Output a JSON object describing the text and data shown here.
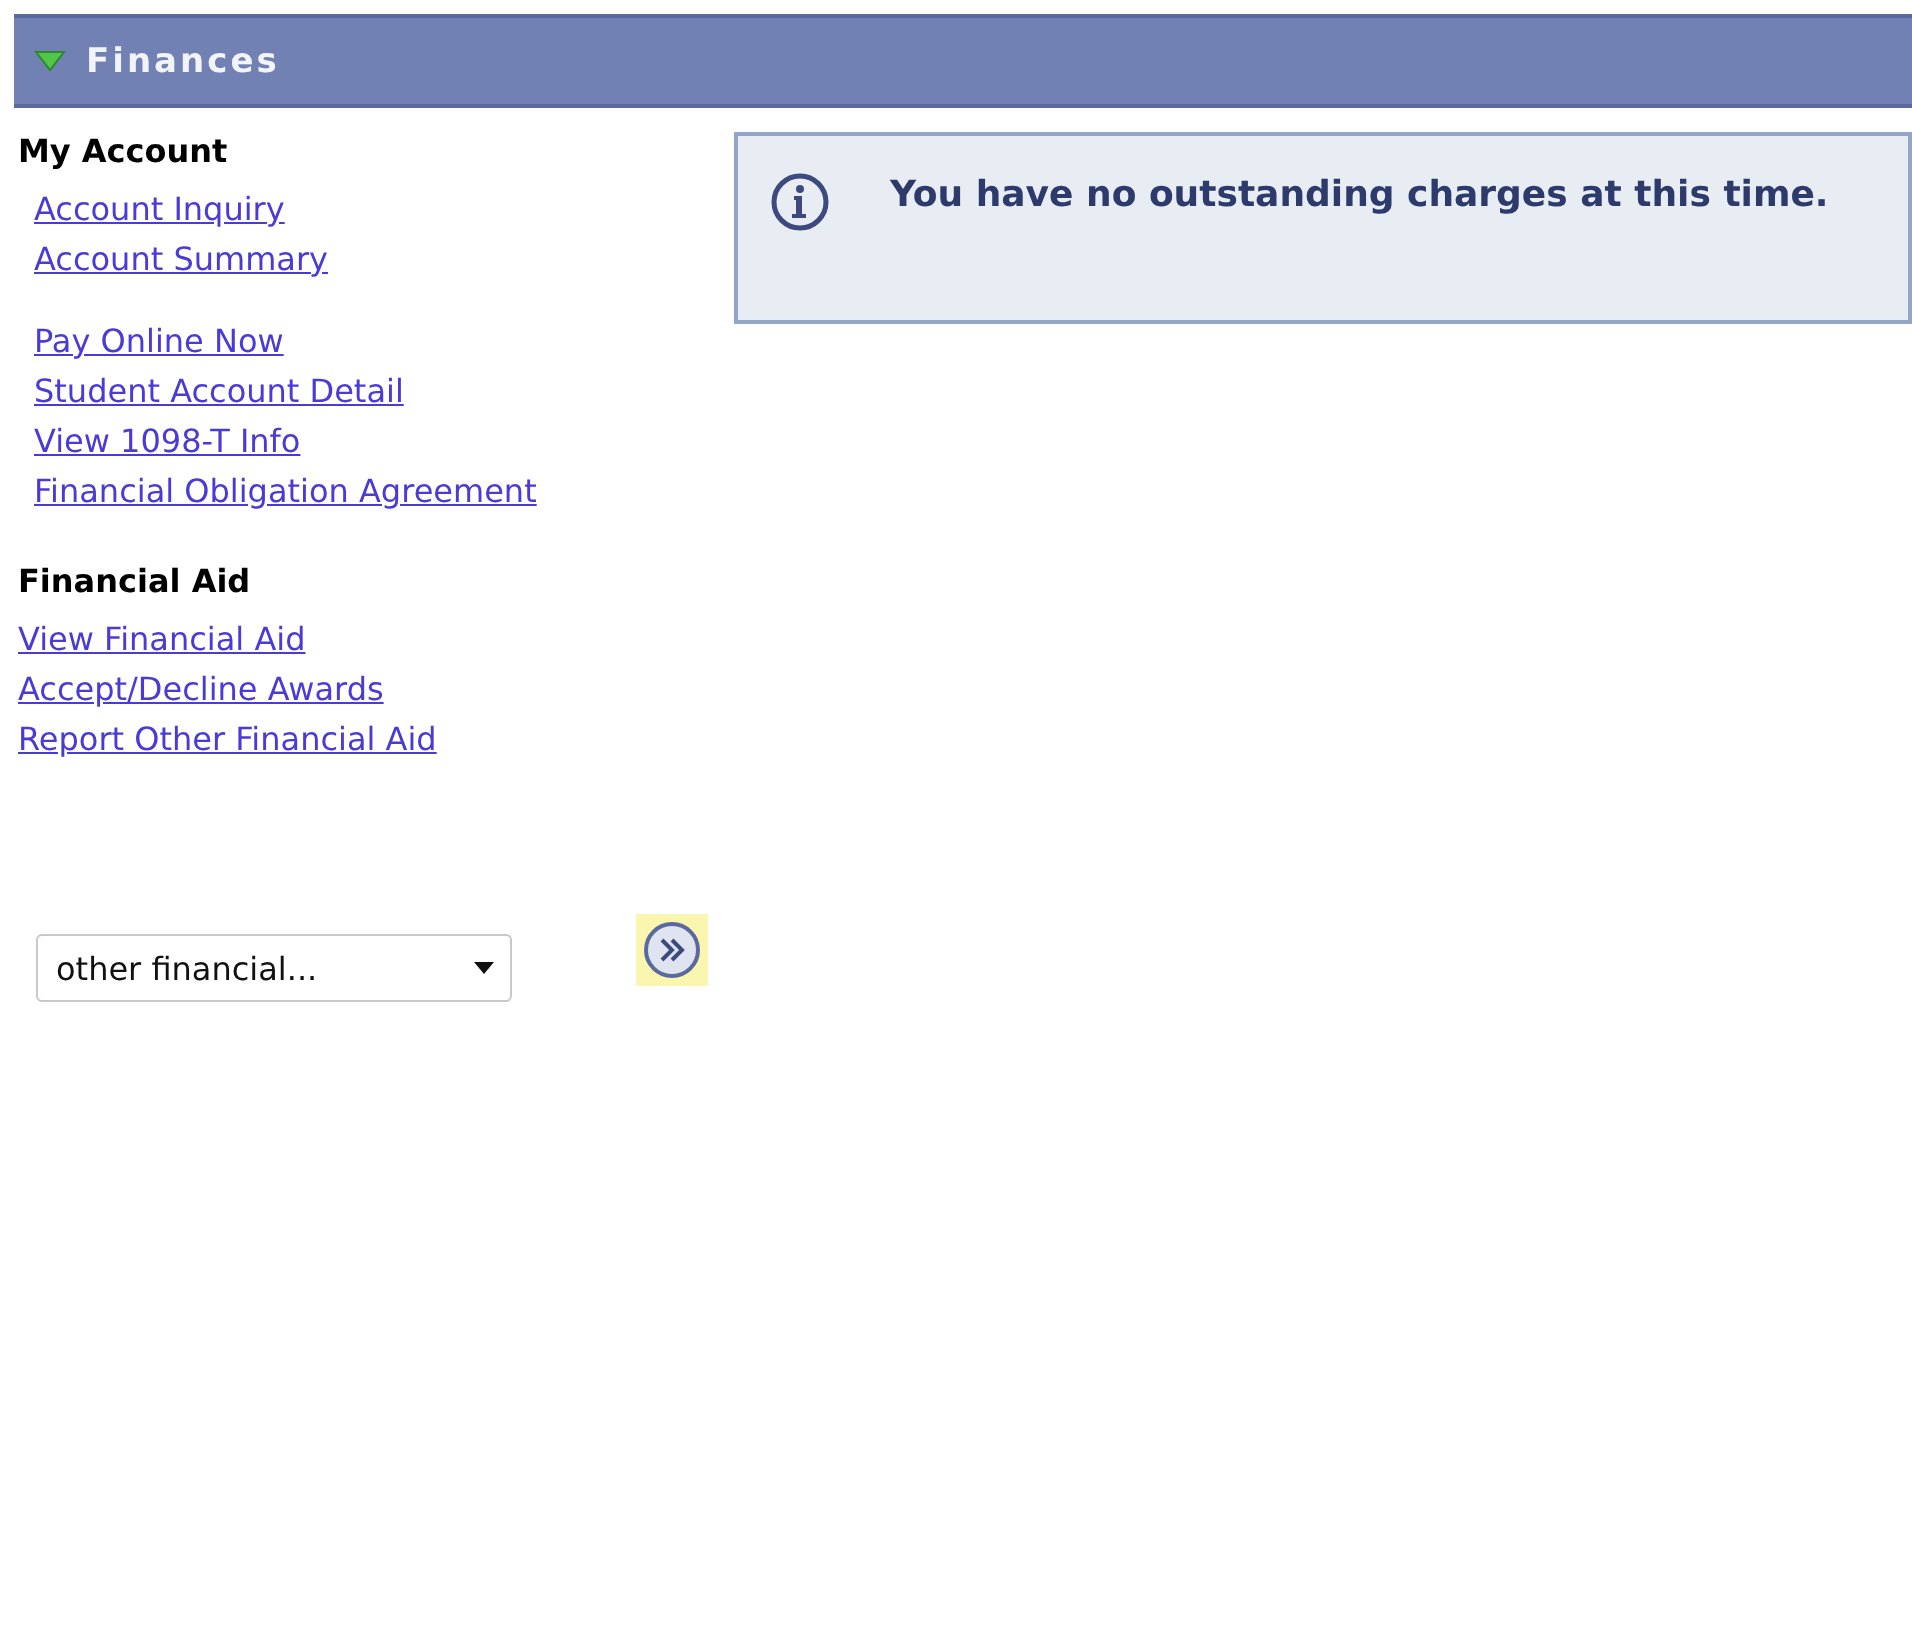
{
  "header": {
    "title": "Finances",
    "expanded": true
  },
  "sections": [
    {
      "heading": "My Account",
      "kind": "indented",
      "groups": [
        [
          "Account Inquiry",
          "Account Summary"
        ],
        [
          "Pay Online Now",
          "Student Account Detail",
          "View 1098-T Info",
          "Financial Obligation Agreement"
        ]
      ]
    },
    {
      "heading": "Financial Aid",
      "kind": "flush",
      "groups": [
        [
          "View Financial Aid",
          "Accept/Decline Awards",
          "Report Other Financial Aid"
        ]
      ]
    }
  ],
  "message": {
    "text": "You have no outstanding charges at this time."
  },
  "select": {
    "value": "other financial..."
  }
}
